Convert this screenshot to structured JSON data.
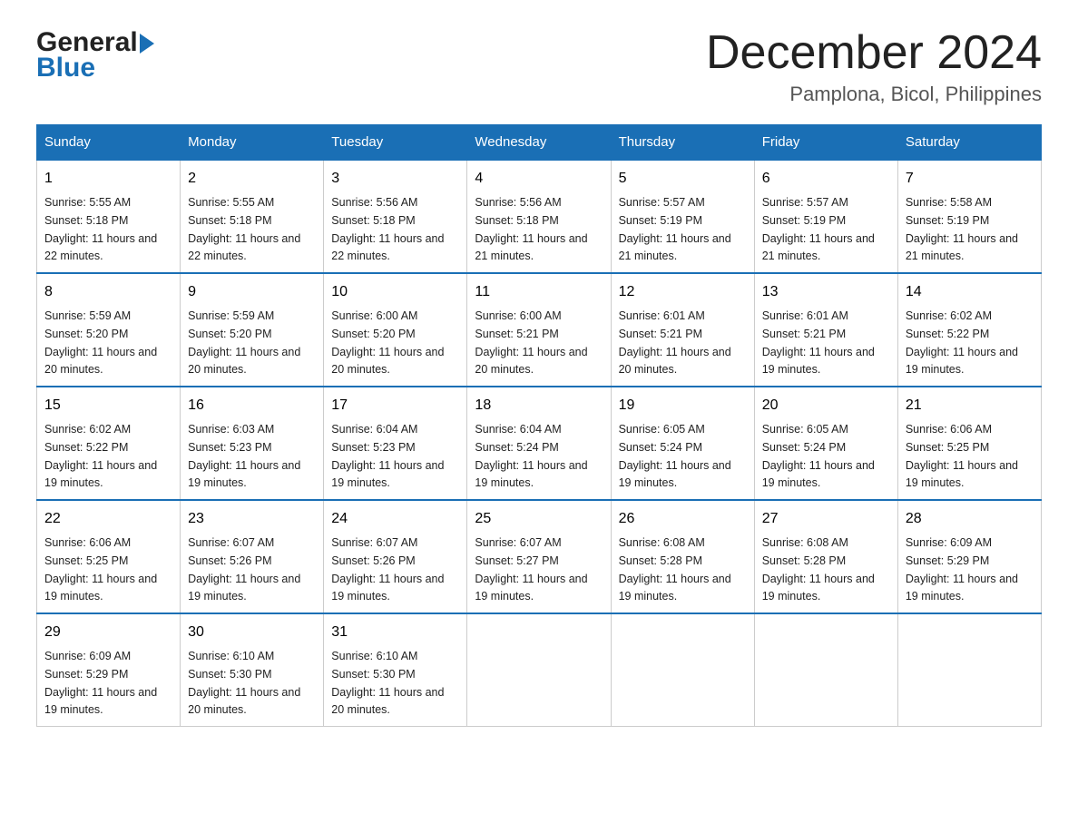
{
  "logo": {
    "general": "General",
    "blue": "Blue"
  },
  "title": "December 2024",
  "subtitle": "Pamplona, Bicol, Philippines",
  "days_of_week": [
    "Sunday",
    "Monday",
    "Tuesday",
    "Wednesday",
    "Thursday",
    "Friday",
    "Saturday"
  ],
  "weeks": [
    [
      {
        "day": "1",
        "sunrise": "5:55 AM",
        "sunset": "5:18 PM",
        "daylight": "11 hours and 22 minutes."
      },
      {
        "day": "2",
        "sunrise": "5:55 AM",
        "sunset": "5:18 PM",
        "daylight": "11 hours and 22 minutes."
      },
      {
        "day": "3",
        "sunrise": "5:56 AM",
        "sunset": "5:18 PM",
        "daylight": "11 hours and 22 minutes."
      },
      {
        "day": "4",
        "sunrise": "5:56 AM",
        "sunset": "5:18 PM",
        "daylight": "11 hours and 21 minutes."
      },
      {
        "day": "5",
        "sunrise": "5:57 AM",
        "sunset": "5:19 PM",
        "daylight": "11 hours and 21 minutes."
      },
      {
        "day": "6",
        "sunrise": "5:57 AM",
        "sunset": "5:19 PM",
        "daylight": "11 hours and 21 minutes."
      },
      {
        "day": "7",
        "sunrise": "5:58 AM",
        "sunset": "5:19 PM",
        "daylight": "11 hours and 21 minutes."
      }
    ],
    [
      {
        "day": "8",
        "sunrise": "5:59 AM",
        "sunset": "5:20 PM",
        "daylight": "11 hours and 20 minutes."
      },
      {
        "day": "9",
        "sunrise": "5:59 AM",
        "sunset": "5:20 PM",
        "daylight": "11 hours and 20 minutes."
      },
      {
        "day": "10",
        "sunrise": "6:00 AM",
        "sunset": "5:20 PM",
        "daylight": "11 hours and 20 minutes."
      },
      {
        "day": "11",
        "sunrise": "6:00 AM",
        "sunset": "5:21 PM",
        "daylight": "11 hours and 20 minutes."
      },
      {
        "day": "12",
        "sunrise": "6:01 AM",
        "sunset": "5:21 PM",
        "daylight": "11 hours and 20 minutes."
      },
      {
        "day": "13",
        "sunrise": "6:01 AM",
        "sunset": "5:21 PM",
        "daylight": "11 hours and 19 minutes."
      },
      {
        "day": "14",
        "sunrise": "6:02 AM",
        "sunset": "5:22 PM",
        "daylight": "11 hours and 19 minutes."
      }
    ],
    [
      {
        "day": "15",
        "sunrise": "6:02 AM",
        "sunset": "5:22 PM",
        "daylight": "11 hours and 19 minutes."
      },
      {
        "day": "16",
        "sunrise": "6:03 AM",
        "sunset": "5:23 PM",
        "daylight": "11 hours and 19 minutes."
      },
      {
        "day": "17",
        "sunrise": "6:04 AM",
        "sunset": "5:23 PM",
        "daylight": "11 hours and 19 minutes."
      },
      {
        "day": "18",
        "sunrise": "6:04 AM",
        "sunset": "5:24 PM",
        "daylight": "11 hours and 19 minutes."
      },
      {
        "day": "19",
        "sunrise": "6:05 AM",
        "sunset": "5:24 PM",
        "daylight": "11 hours and 19 minutes."
      },
      {
        "day": "20",
        "sunrise": "6:05 AM",
        "sunset": "5:24 PM",
        "daylight": "11 hours and 19 minutes."
      },
      {
        "day": "21",
        "sunrise": "6:06 AM",
        "sunset": "5:25 PM",
        "daylight": "11 hours and 19 minutes."
      }
    ],
    [
      {
        "day": "22",
        "sunrise": "6:06 AM",
        "sunset": "5:25 PM",
        "daylight": "11 hours and 19 minutes."
      },
      {
        "day": "23",
        "sunrise": "6:07 AM",
        "sunset": "5:26 PM",
        "daylight": "11 hours and 19 minutes."
      },
      {
        "day": "24",
        "sunrise": "6:07 AM",
        "sunset": "5:26 PM",
        "daylight": "11 hours and 19 minutes."
      },
      {
        "day": "25",
        "sunrise": "6:07 AM",
        "sunset": "5:27 PM",
        "daylight": "11 hours and 19 minutes."
      },
      {
        "day": "26",
        "sunrise": "6:08 AM",
        "sunset": "5:28 PM",
        "daylight": "11 hours and 19 minutes."
      },
      {
        "day": "27",
        "sunrise": "6:08 AM",
        "sunset": "5:28 PM",
        "daylight": "11 hours and 19 minutes."
      },
      {
        "day": "28",
        "sunrise": "6:09 AM",
        "sunset": "5:29 PM",
        "daylight": "11 hours and 19 minutes."
      }
    ],
    [
      {
        "day": "29",
        "sunrise": "6:09 AM",
        "sunset": "5:29 PM",
        "daylight": "11 hours and 19 minutes."
      },
      {
        "day": "30",
        "sunrise": "6:10 AM",
        "sunset": "5:30 PM",
        "daylight": "11 hours and 20 minutes."
      },
      {
        "day": "31",
        "sunrise": "6:10 AM",
        "sunset": "5:30 PM",
        "daylight": "11 hours and 20 minutes."
      },
      null,
      null,
      null,
      null
    ]
  ],
  "labels": {
    "sunrise": "Sunrise:",
    "sunset": "Sunset:",
    "daylight": "Daylight:"
  }
}
